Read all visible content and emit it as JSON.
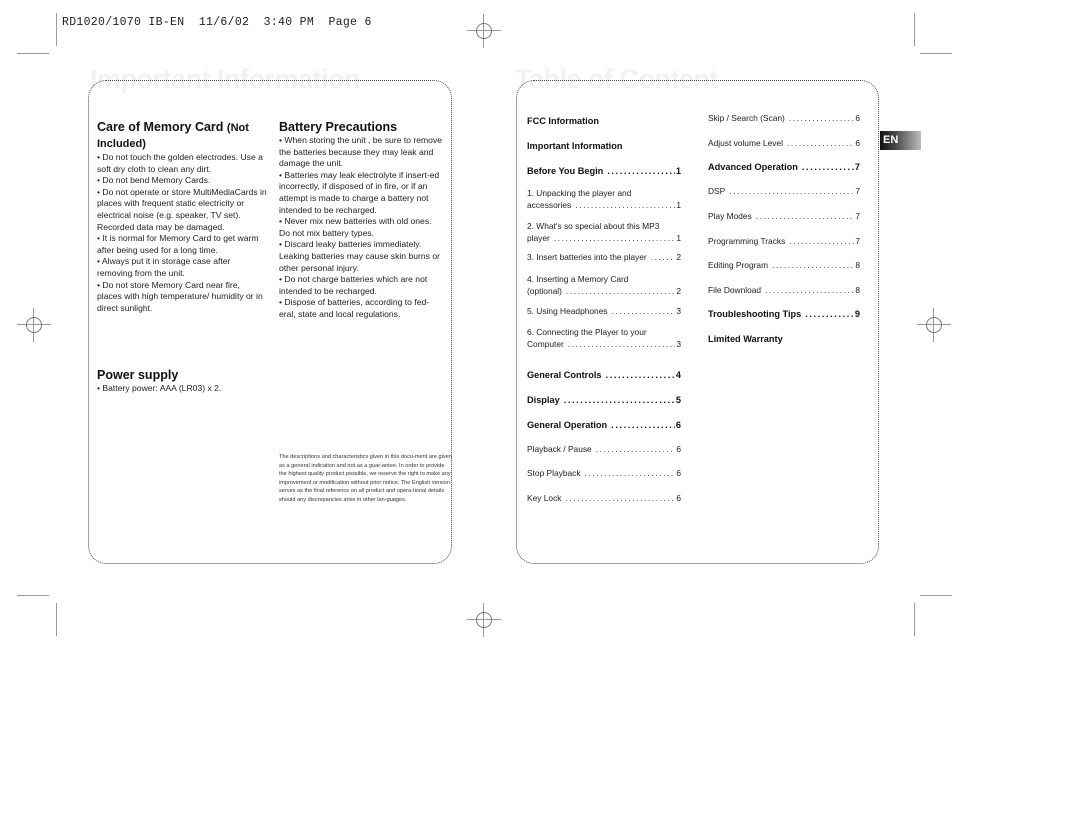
{
  "slug": "RD1020/1070 IB-EN  11/6/02  3:40 PM  Page 6",
  "left_page": {
    "ghost_title": "Important Information",
    "care": {
      "heading": "Care of  Memory Card",
      "heading_suffix": "(Not Included)",
      "paragraphs": [
        "• Do not touch the golden electrodes. Use a soft dry cloth to clean any dirt.",
        "• Do not bend Memory Cards.",
        "• Do not operate or store MultiMediaCards in places with frequent static electricity or electrical noise (e.g. speaker, TV set). Recorded data may be damaged.",
        "• It is normal for Memory Card to get warm after being used for a long time.",
        "• Always put it in storage case after removing from the unit.",
        "• Do not store Memory Card near fire, places with high temperature/ humidity or in direct sunlight."
      ]
    },
    "battery": {
      "heading": "Battery Precautions",
      "paragraphs": [
        "• When storing the unit , be sure to remove the batteries because they may leak and damage the unit.",
        "• Batteries may leak electrolyte if insert-ed incorrectly, if disposed of in fire, or if an attempt is made to charge a battery not intended to be recharged.",
        "• Never mix new batteries with old ones. Do not mix battery types.",
        "• Discard leaky batteries immediately. Leaking batteries may cause skin burns or other personal injury.",
        "• Do not charge batteries which are not intended to be recharged.",
        "• Dispose of batteries, according to fed-eral, state and local regulations."
      ]
    },
    "power": {
      "heading": "Power supply",
      "text": "• Battery power: AAA (LR03) x 2."
    },
    "disclaimer": "The descriptions and characteristics given in this docu-ment are given as a general indication and not as a guar-antee.  In order to provide the highest quality product possible, we reserve the right to make any improvement or modification without prior notice. The English version serves as the final reference on all product and opera-tional details should any discrepancies arise in other lan-guages."
  },
  "right_page": {
    "ghost_title": "Table of Content",
    "language_tab": "EN",
    "toc_col1": [
      {
        "label": "FCC Information",
        "page": "",
        "bold": true
      },
      {
        "label": "Important Information",
        "page": "",
        "bold": true
      },
      {
        "label": "Before You Begin",
        "page": "1",
        "bold": true
      },
      {
        "line1": "1.  Unpacking the player and",
        "label": "accessories",
        "page": "1",
        "bold": false
      },
      {
        "line1": "2.  What's so special about this MP3",
        "label": "player",
        "page": "1",
        "bold": false
      },
      {
        "label": "3.  Insert batteries into the player",
        "page": "2",
        "bold": false
      },
      {
        "line1": "4.  Inserting a Memory Card",
        "label": "(optional)",
        "page": "2",
        "bold": false
      },
      {
        "label": "5.   Using Headphones",
        "page": "3",
        "bold": false
      },
      {
        "line1": "6.   Connecting the Player to your",
        "label": "Computer",
        "page": "3",
        "bold": false
      },
      {
        "label": "General Controls",
        "page": "4",
        "bold": true
      },
      {
        "label": "Display",
        "page": "5",
        "bold": true
      },
      {
        "label": "General Operation",
        "page": "6",
        "bold": true
      },
      {
        "label": "Playback / Pause",
        "page": "6",
        "bold": false
      },
      {
        "label": "Stop Playback",
        "page": "6",
        "bold": false
      },
      {
        "label": "Key Lock",
        "page": "6",
        "bold": false
      }
    ],
    "toc_col2": [
      {
        "label": "Skip / Search (Scan)",
        "page": "6",
        "bold": false
      },
      {
        "label": "Adjust volume Level",
        "page": "6",
        "bold": false
      },
      {
        "label": "Advanced Operation",
        "page": "7",
        "bold": true
      },
      {
        "label": "DSP",
        "page": "7",
        "bold": false
      },
      {
        "label": "Play Modes",
        "page": "7",
        "bold": false
      },
      {
        "label": "Programming Tracks",
        "page": "7",
        "bold": false
      },
      {
        "label": "Editing Program",
        "page": "8",
        "bold": false
      },
      {
        "label": "File Download",
        "page": "8",
        "bold": false
      },
      {
        "label": "Troubleshooting Tips",
        "page": "9",
        "bold": true
      },
      {
        "label": "Limited Warranty",
        "page": "",
        "bold": true
      }
    ]
  }
}
